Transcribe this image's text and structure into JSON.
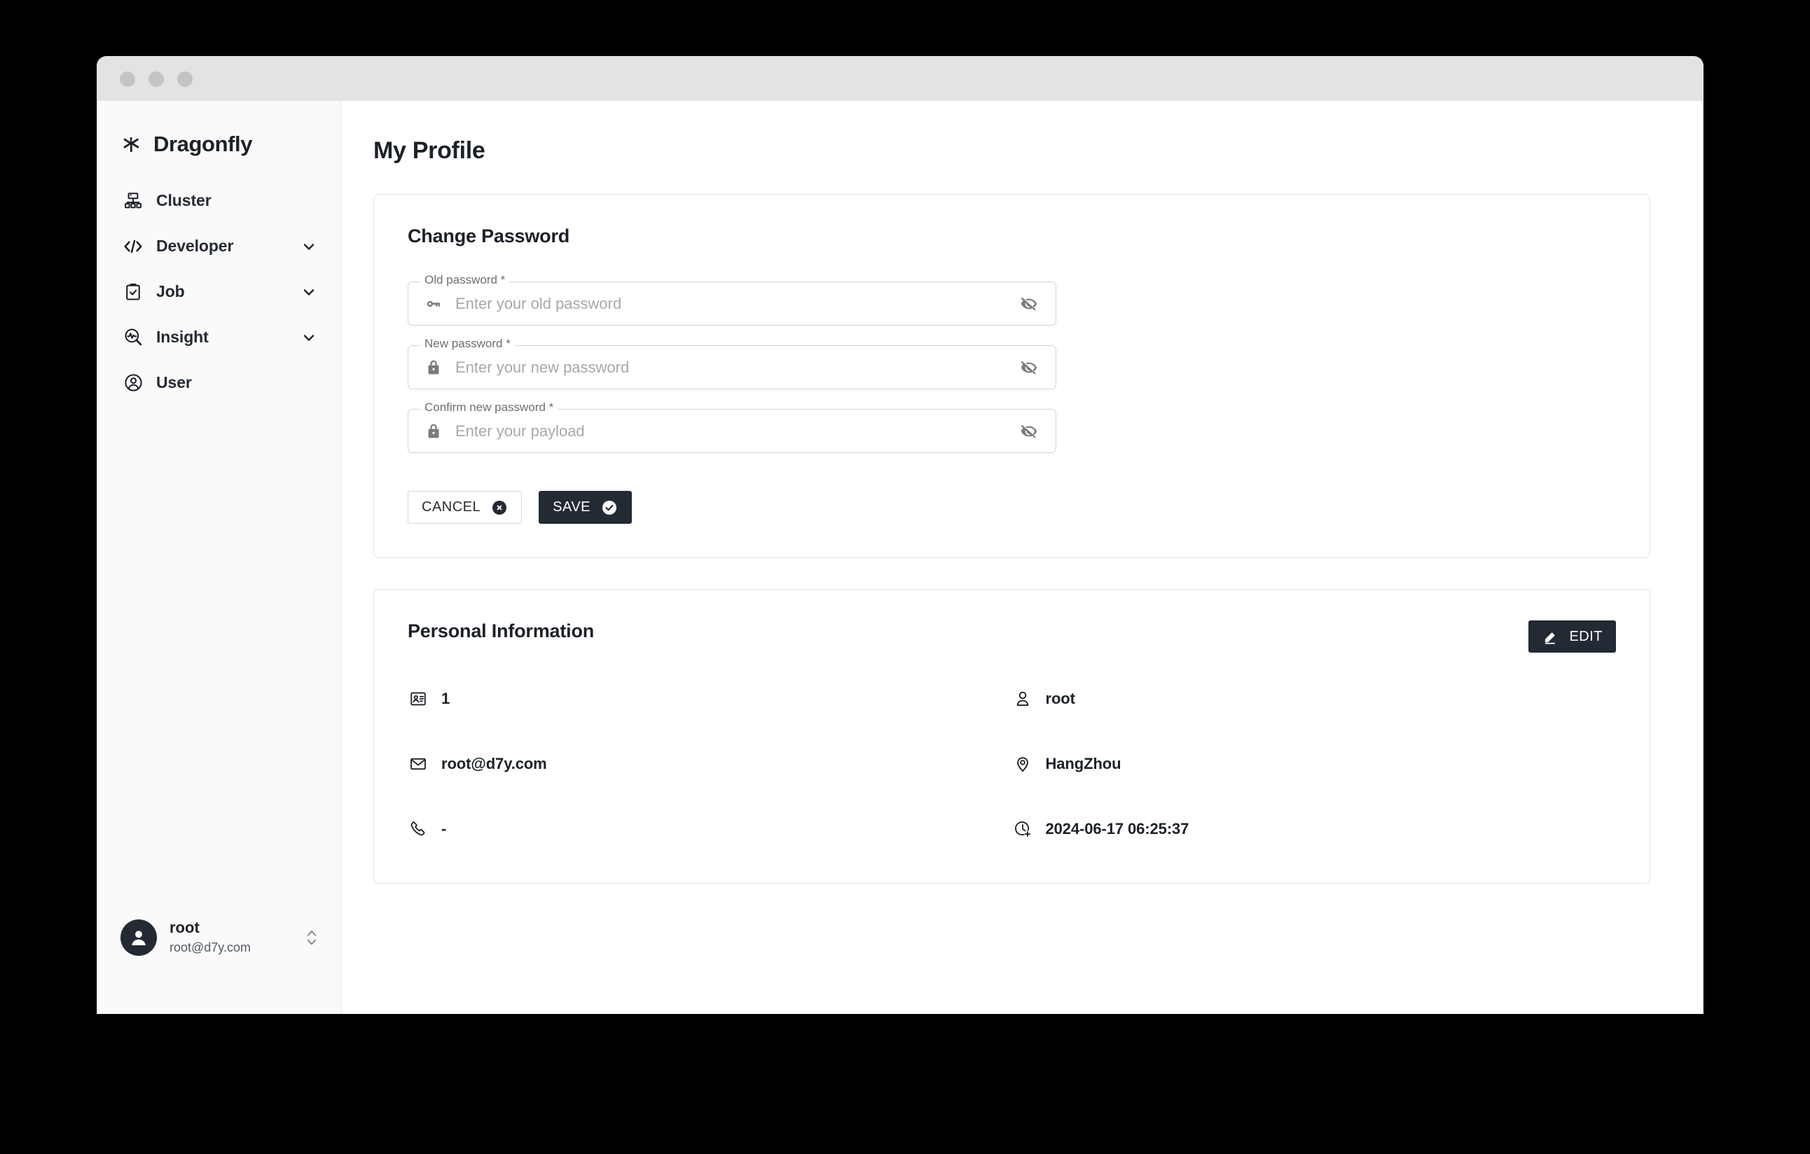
{
  "window": {
    "traffic_lights": [
      "close",
      "minimize",
      "maximize"
    ]
  },
  "sidebar": {
    "brand": {
      "name": "Dragonfly",
      "icon": "dragonfly-logo-icon"
    },
    "items": [
      {
        "label": "Cluster",
        "icon": "cluster-icon",
        "expandable": false
      },
      {
        "label": "Developer",
        "icon": "code-icon",
        "expandable": true
      },
      {
        "label": "Job",
        "icon": "clipboard-check-icon",
        "expandable": true
      },
      {
        "label": "Insight",
        "icon": "insight-search-icon",
        "expandable": true
      },
      {
        "label": "User",
        "icon": "user-circle-icon",
        "expandable": false
      }
    ],
    "account": {
      "name": "root",
      "email": "root@d7y.com",
      "avatar_icon": "person-avatar-icon",
      "selector_icon": "unfold-more-icon"
    }
  },
  "main": {
    "page_title": "My Profile",
    "change_password": {
      "title": "Change Password",
      "fields": [
        {
          "label": "Old password *",
          "placeholder": "Enter your old password",
          "value": "",
          "lead_icon": "key-icon",
          "trail_icon": "eye-off-icon"
        },
        {
          "label": "New password *",
          "placeholder": "Enter your new password",
          "value": "",
          "lead_icon": "lock-icon",
          "trail_icon": "eye-off-icon"
        },
        {
          "label": "Confirm new password *",
          "placeholder": "Enter your payload",
          "value": "",
          "lead_icon": "lock-icon",
          "trail_icon": "eye-off-icon"
        }
      ],
      "cancel_label": "CANCEL",
      "cancel_icon": "cancel-circle-icon",
      "save_label": "SAVE",
      "save_icon": "check-circle-icon"
    },
    "personal_information": {
      "title": "Personal Information",
      "edit_label": "EDIT",
      "edit_icon": "pencil-edit-icon",
      "items": [
        {
          "icon": "id-card-icon",
          "value": "1"
        },
        {
          "icon": "person-icon",
          "value": "root"
        },
        {
          "icon": "mail-icon",
          "value": "root@d7y.com"
        },
        {
          "icon": "location-pin-icon",
          "value": "HangZhou"
        },
        {
          "icon": "phone-icon",
          "value": "-"
        },
        {
          "icon": "clock-add-icon",
          "value": "2024-06-17 06:25:37"
        }
      ]
    }
  },
  "colors": {
    "accent_dark": "#242a33",
    "text_primary": "#1c2128",
    "sidebar_bg": "#fafafa",
    "titlebar_bg": "#e3e3e3",
    "card_border": "#e4e4e4",
    "page_bg": "#000000"
  }
}
